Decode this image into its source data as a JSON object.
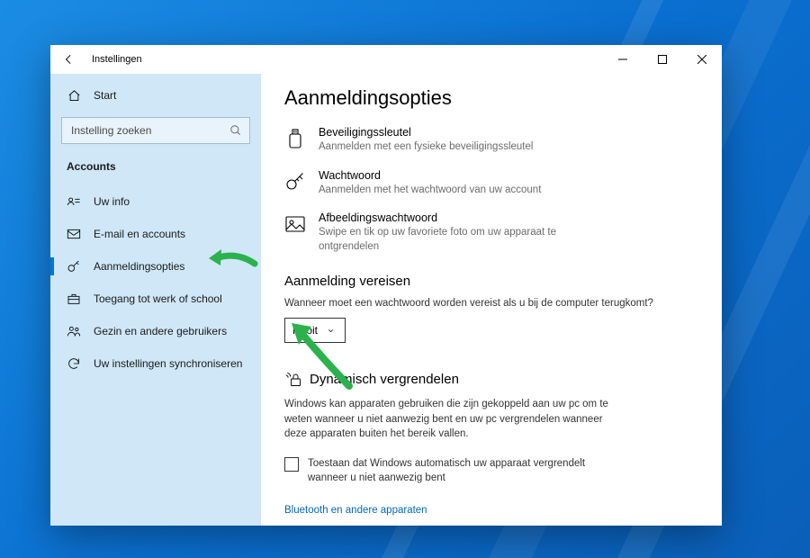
{
  "window": {
    "title": "Instellingen"
  },
  "sidebar": {
    "home": "Start",
    "search_placeholder": "Instelling zoeken",
    "section": "Accounts",
    "items": [
      {
        "label": "Uw info"
      },
      {
        "label": "E-mail en accounts"
      },
      {
        "label": "Aanmeldingsopties"
      },
      {
        "label": "Toegang tot werk of school"
      },
      {
        "label": "Gezin en andere gebruikers"
      },
      {
        "label": "Uw instellingen synchroniseren"
      }
    ]
  },
  "content": {
    "heading": "Aanmeldingsopties",
    "options": [
      {
        "title": "Beveiligingssleutel",
        "desc": "Aanmelden met een fysieke beveiligingssleutel"
      },
      {
        "title": "Wachtwoord",
        "desc": "Aanmelden met het wachtwoord van uw account"
      },
      {
        "title": "Afbeeldingswachtwoord",
        "desc": "Swipe en tik op uw favoriete foto om uw apparaat te ontgrendelen"
      }
    ],
    "require": {
      "heading": "Aanmelding vereisen",
      "desc": "Wanneer moet een wachtwoord worden vereist als u bij de computer terugkomt?",
      "value": "Nooit"
    },
    "dynamic": {
      "heading": "Dynamisch vergrendelen",
      "desc": "Windows kan apparaten gebruiken die zijn gekoppeld aan uw pc om te weten wanneer u niet aanwezig bent en uw pc vergrendelen wanneer deze apparaten buiten het bereik vallen.",
      "checkbox": "Toestaan dat Windows automatisch uw apparaat vergrendelt wanneer u niet aanwezig bent",
      "link": "Bluetooth en andere apparaten"
    }
  }
}
